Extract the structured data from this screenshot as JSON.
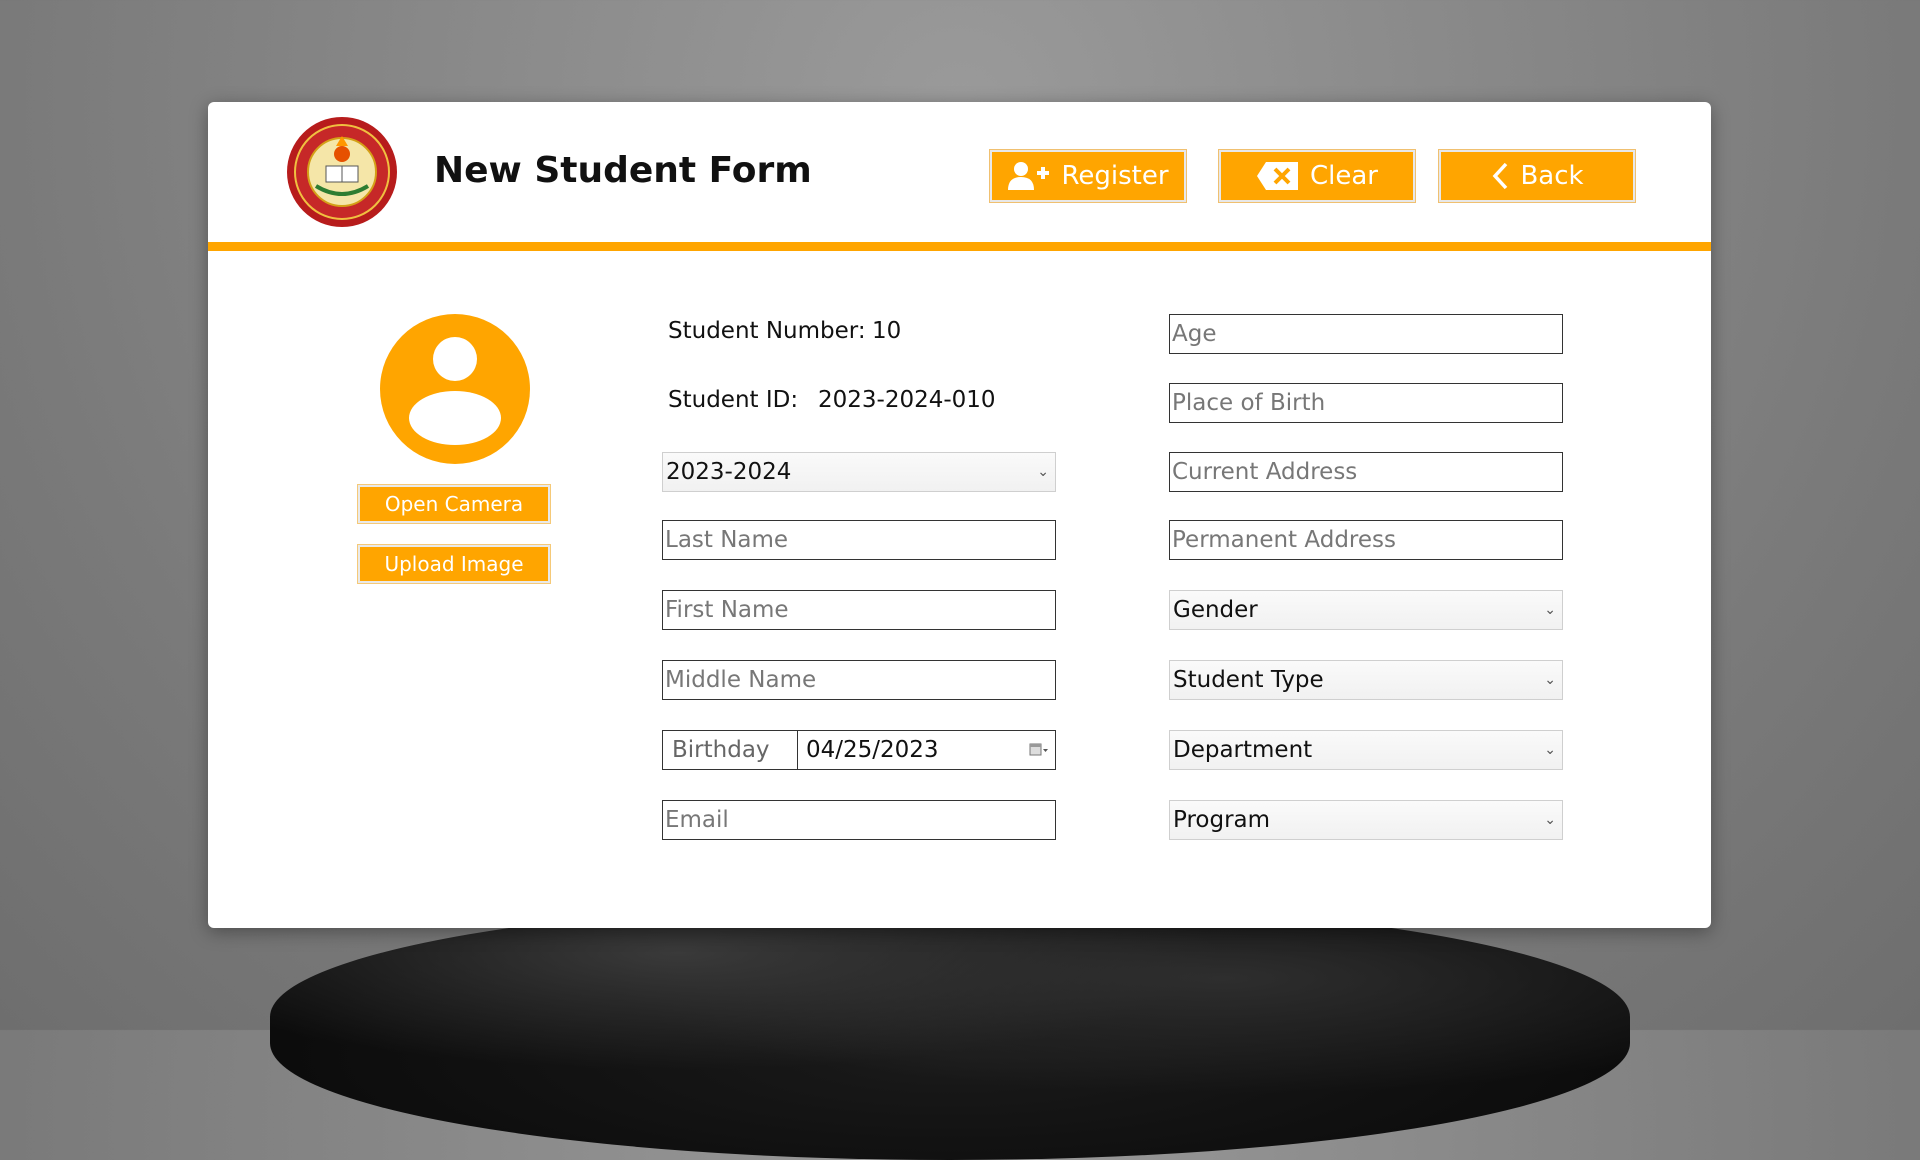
{
  "header": {
    "title": "New Student Form",
    "logo_icon": "university-seal-logo",
    "buttons": {
      "register": "Register",
      "clear": "Clear",
      "back": "Back"
    }
  },
  "photo": {
    "open_camera": "Open Camera",
    "upload_image": "Upload Image"
  },
  "info": {
    "student_number_label": "Student Number:",
    "student_number_value": "10",
    "student_id_label": "Student ID:",
    "student_id_value": "2023-2024-010"
  },
  "left_fields": {
    "school_year": "2023-2024",
    "last_name_placeholder": "Last Name",
    "first_name_placeholder": "First Name",
    "middle_name_placeholder": "Middle Name",
    "birthday_label": "Birthday",
    "birthday_value": "04/25/2023",
    "email_placeholder": "Email"
  },
  "right_fields": {
    "age_placeholder": "Age",
    "place_of_birth_placeholder": "Place of Birth",
    "current_address_placeholder": "Current Address",
    "permanent_address_placeholder": "Permanent Address",
    "gender": "Gender",
    "student_type": "Student Type",
    "department": "Department",
    "program": "Program"
  },
  "colors": {
    "accent": "#FFA500",
    "window_bg": "#FFFFFF",
    "desktop_bg": "#808080"
  }
}
